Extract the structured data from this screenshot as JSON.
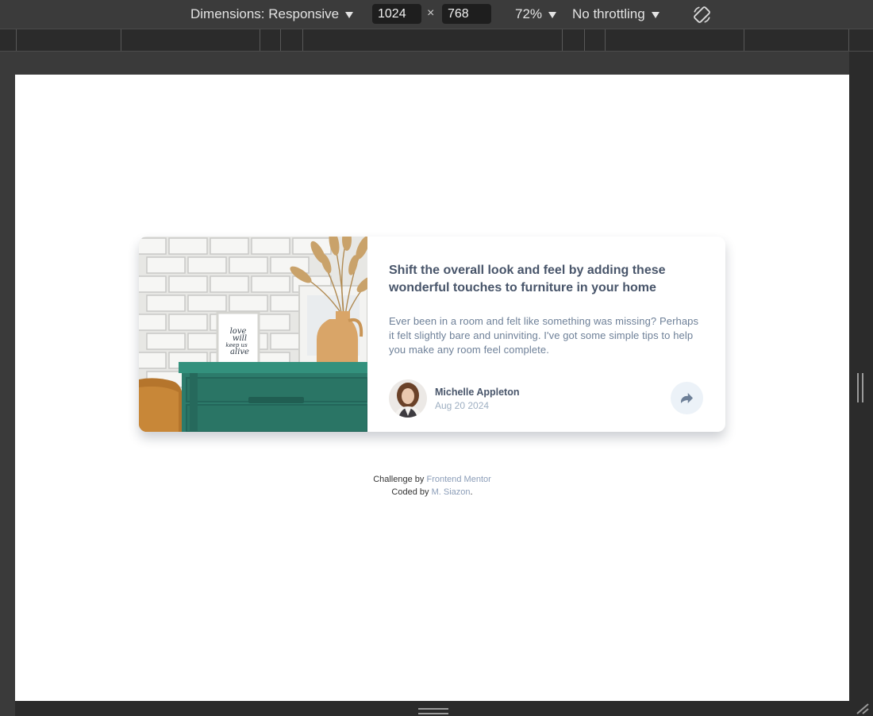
{
  "devtools": {
    "dimensions_label": "Dimensions: Responsive",
    "width_value": "1024",
    "height_value": "768",
    "times_symbol": "×",
    "zoom_label": "72%",
    "throttling_label": "No throttling",
    "icons": [
      "caret-down-icon",
      "rotate-icon",
      "resize-handle-icon"
    ]
  },
  "card": {
    "title": "Shift the overall look and feel by adding these wonderful touches to furniture in your home",
    "excerpt": "Ever been in a room and felt like something was missing? Perhaps it felt slightly bare and uninviting. I've got some simple tips to help you make any room feel complete.",
    "author_name": "Michelle Appleton",
    "author_date": "Aug 20 2024",
    "frame_text_lines": [
      "love",
      "will",
      "keep us",
      "alive"
    ],
    "share_icon": "share-icon"
  },
  "attribution": {
    "line1_prefix": "Challenge by",
    "line1_link": "Frontend Mentor",
    "line2_prefix": "Coded by",
    "line2_link": "M. Siazon",
    "line2_suffix": "."
  },
  "colors": {
    "heading": "#48556a",
    "body_text": "#6e8098",
    "muted": "#9eafc2",
    "share_bg": "#ecf2f8",
    "link": "#8b9db8"
  }
}
